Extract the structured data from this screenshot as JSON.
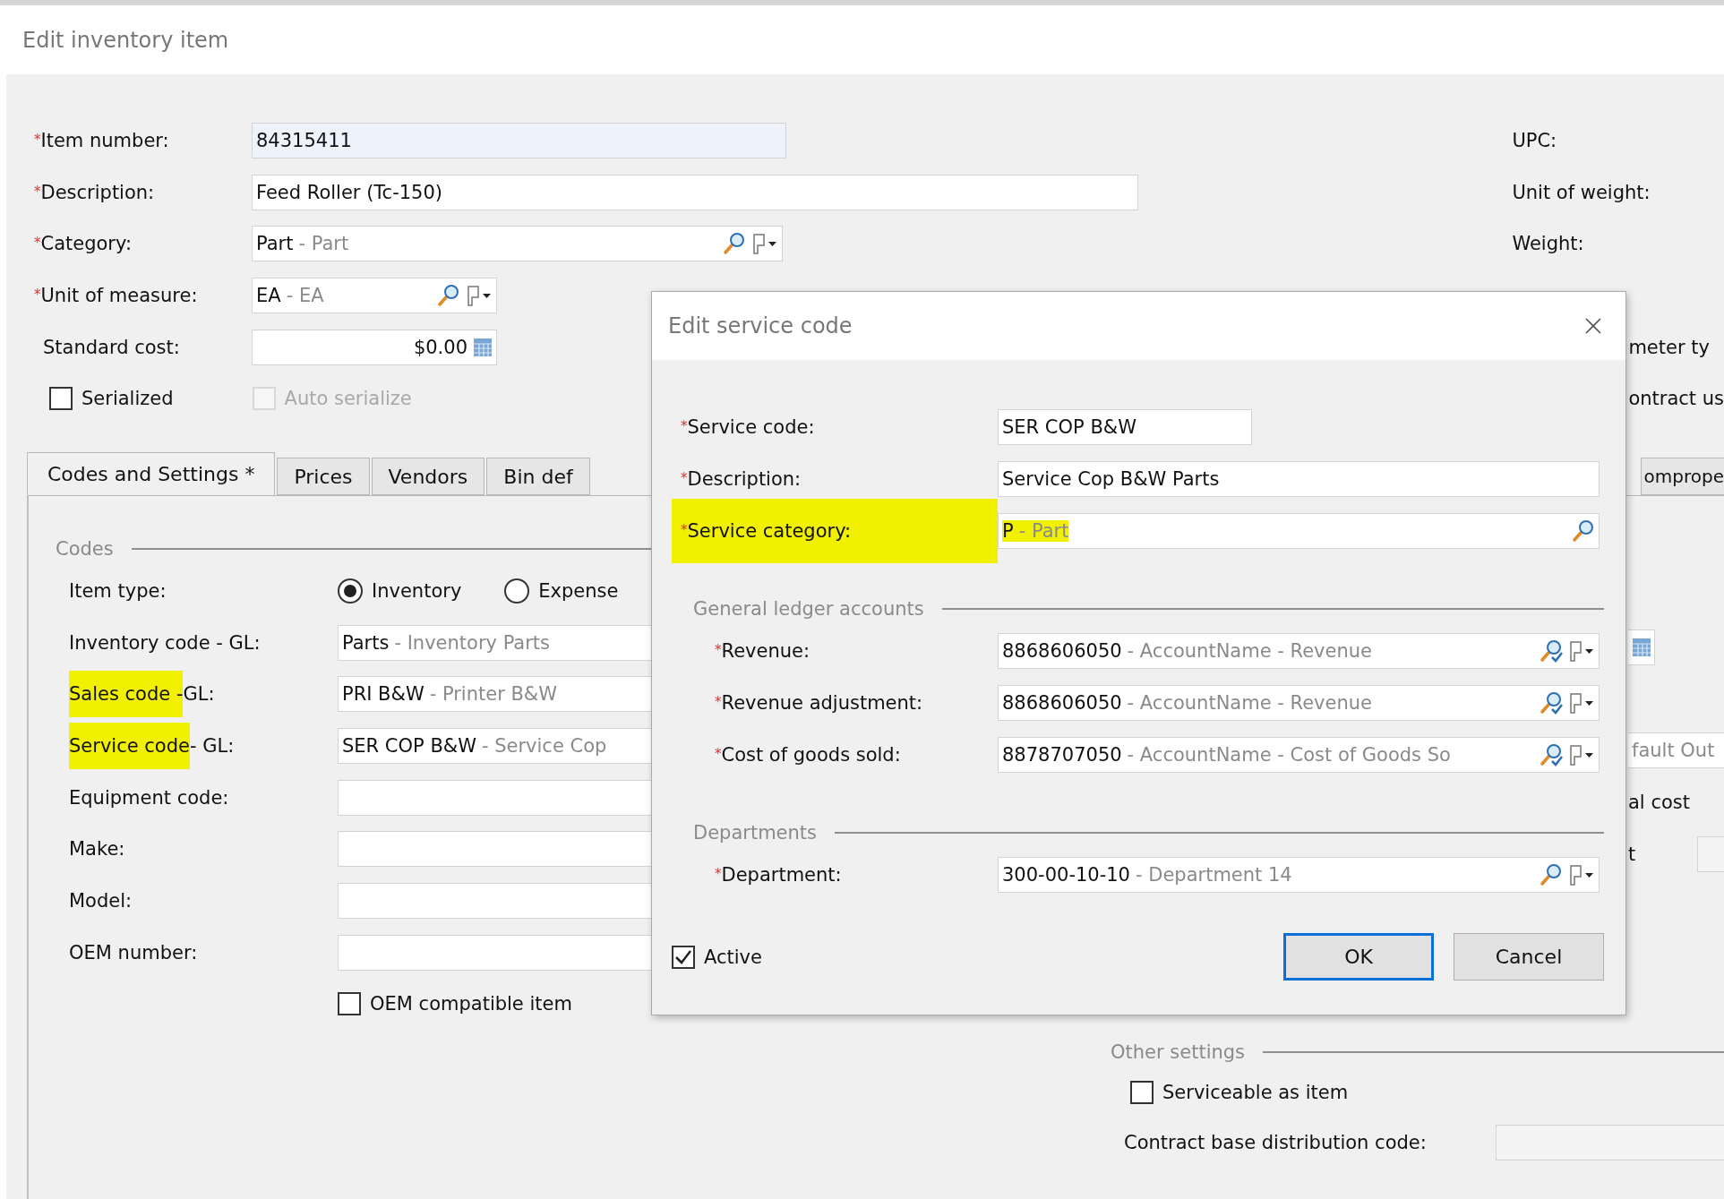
{
  "page_title": "Edit inventory item",
  "main_fields": [
    {
      "kind": "text",
      "marker": "*",
      "label": "Item number:",
      "readonly": true,
      "value": "84315411"
    },
    {
      "kind": "text",
      "marker": "*",
      "label": "Description:",
      "readonly": false,
      "value": "Feed Roller (Tc-150)"
    },
    {
      "kind": "lookup",
      "marker": "*",
      "label": "Category:",
      "readonly": false,
      "value": "Part",
      "detail": "- Part"
    },
    {
      "kind": "lookup",
      "marker": "*",
      "label": "Unit of measure:",
      "readonly": false,
      "value": "EA",
      "detail": "- EA"
    },
    {
      "kind": "amount",
      "label": "Standard cost:",
      "readonly": false,
      "value": "$0.00"
    }
  ],
  "main_checks": [
    {
      "label": "Serialized",
      "checked": false,
      "disabled": false
    },
    {
      "label": "Auto serialize",
      "checked": false,
      "disabled": true
    }
  ],
  "right_labels": [
    "UPC:",
    "Unit of weight:",
    "Weight:"
  ],
  "right_fragments": [
    "meter ty",
    "ontract us"
  ],
  "tabs": [
    {
      "label": "Codes and Settings *",
      "selected": true
    },
    {
      "label": "Prices",
      "selected": false
    },
    {
      "label": "Vendors",
      "selected": false
    },
    {
      "label": "Bin def",
      "selected": false
    },
    {
      "label": "omprope",
      "selected": false
    }
  ],
  "codes": {
    "title": "Codes",
    "item_type": {
      "label": "Item type:",
      "options": [
        {
          "label": "Inventory",
          "selected": true
        },
        {
          "label": "Expense",
          "selected": false
        }
      ]
    },
    "rows": [
      {
        "label": "Inventory code - GL:",
        "value": "Parts",
        "detail": "- Inventory Parts"
      },
      {
        "label_highlight": "Sales code - ",
        "label": "GL:",
        "value": "PRI B&W",
        "detail": "- Printer B&W"
      },
      {
        "label_highlight": "Service code",
        "label": " - GL:",
        "value": "SER COP B&W",
        "detail": "- Service Cop"
      },
      {
        "label": "Equipment code:"
      },
      {
        "label": "Make:"
      },
      {
        "label": "Model:"
      },
      {
        "label": "OEM number:"
      }
    ],
    "oem_check": {
      "label": "OEM compatible item",
      "checked": false
    }
  },
  "side_fragments": {
    "field_value": "fault Out",
    "label_1": "al cost",
    "label_2": "t"
  },
  "other_settings": {
    "title": "Other settings",
    "check": {
      "label": "Serviceable as item",
      "checked": false
    },
    "field_label": "Contract base distribution code:"
  },
  "modal": {
    "title": "Edit service code",
    "fields": [
      {
        "kind": "text",
        "marker": "*",
        "label": "Service code:",
        "value": "SER COP B&W",
        "highlighted": false
      },
      {
        "kind": "text",
        "marker": "*",
        "label": "Description:",
        "value": "Service Cop B&W Parts",
        "highlighted": false
      },
      {
        "kind": "search",
        "marker": "*",
        "label": "Service category:",
        "value": "P",
        "detail": "- Part",
        "highlighted": true
      }
    ],
    "groups": [
      {
        "title": "General ledger accounts",
        "fields": [
          {
            "kind": "account",
            "marker": "*",
            "label": "Revenue:",
            "value": "8868606050",
            "detail": "- AccountName - Revenue"
          },
          {
            "kind": "account",
            "marker": "*",
            "label": "Revenue adjustment:",
            "value": "8868606050",
            "detail": "- AccountName - Revenue"
          },
          {
            "kind": "account",
            "marker": "*",
            "label": "Cost of goods sold:",
            "value": "8878707050",
            "detail": "- AccountName - Cost of Goods So"
          }
        ]
      },
      {
        "title": "Departments",
        "fields": [
          {
            "kind": "lookup",
            "marker": "*",
            "label": "Department:",
            "value": "300-00-10-10",
            "detail": "- Department 14"
          }
        ]
      }
    ],
    "active": {
      "label": "Active",
      "checked": true
    },
    "buttons": [
      {
        "label": "OK",
        "default": true
      },
      {
        "label": "Cancel",
        "default": false
      }
    ]
  }
}
